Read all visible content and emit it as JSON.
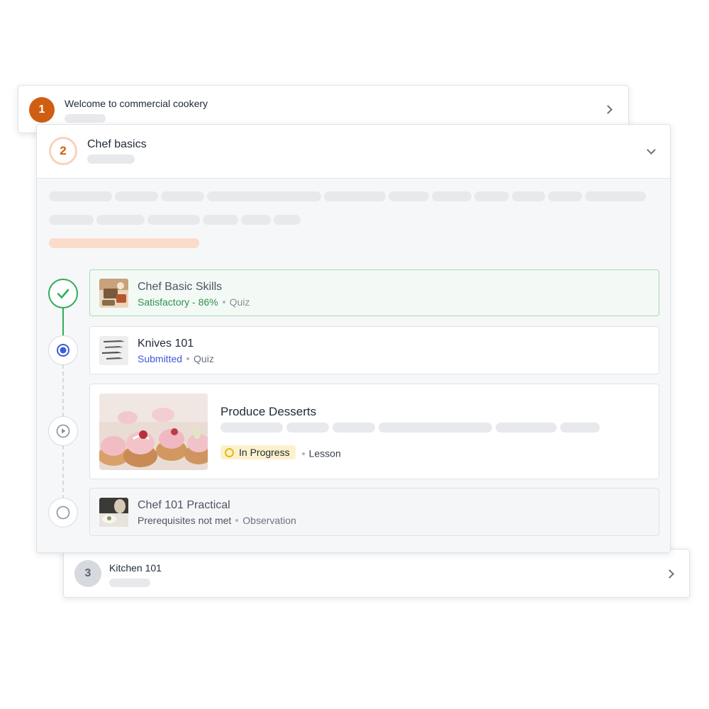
{
  "modules": [
    {
      "number": "1",
      "title": "Welcome to commercial cookery"
    },
    {
      "number": "2",
      "title": "Chef basics"
    },
    {
      "number": "3",
      "title": "Kitchen 101"
    }
  ],
  "lessons": [
    {
      "title": "Chef Basic Skills",
      "status": "Satisfactory - 86%",
      "type": "Quiz",
      "state": "completed"
    },
    {
      "title": "Knives 101",
      "status": "Submitted",
      "type": "Quiz",
      "state": "current"
    },
    {
      "title": "Produce Desserts",
      "status": "In Progress",
      "type": "Lesson",
      "state": "in-progress"
    },
    {
      "title": "Chef 101 Practical",
      "status": "Prerequisites not met",
      "type": "Observation",
      "state": "locked"
    }
  ],
  "icons": {
    "completed": "checkmark-icon",
    "current": "radio-selected-icon",
    "in_progress": "play-circle-icon",
    "locked": "empty-circle-icon",
    "collapsed": "chevron-right-icon",
    "expanded": "chevron-down-icon"
  },
  "colors": {
    "accent": "#cf5e12",
    "success": "#2fae58",
    "link": "#3d5bd9",
    "pending": "#e4b912"
  }
}
